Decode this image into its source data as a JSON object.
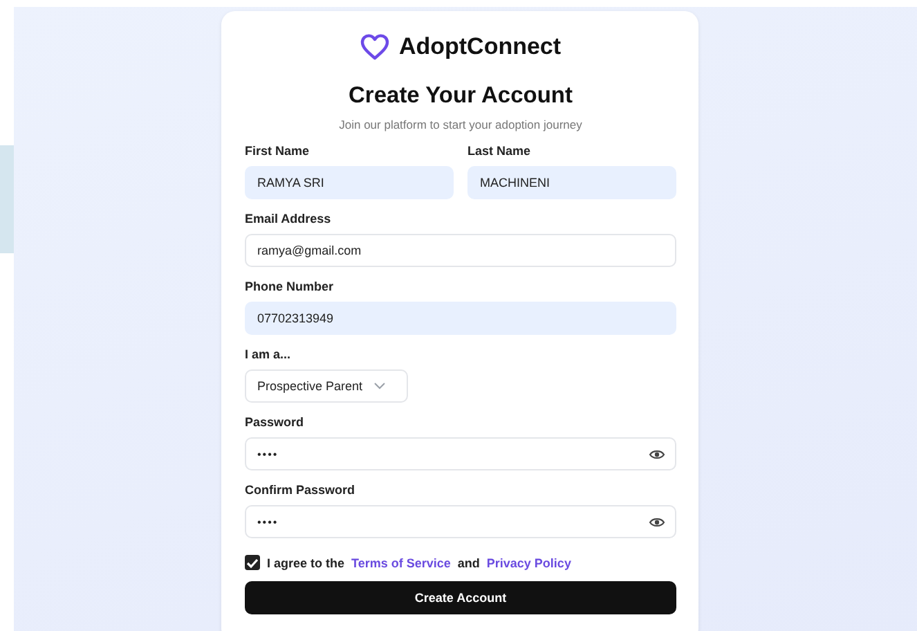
{
  "brand": {
    "name": "AdoptConnect"
  },
  "heading": "Create Your Account",
  "subtitle": "Join our platform to start your adoption journey",
  "rows": [
    {
      "fields": [
        {
          "kind": "text",
          "label": "First Name",
          "value": "RAMYA SRI",
          "autofilled": true
        },
        {
          "kind": "text",
          "label": "Last Name",
          "value": "MACHINENI",
          "autofilled": true
        }
      ]
    },
    {
      "fields": [
        {
          "kind": "text",
          "label": "Email Address",
          "value": "ramya@gmail.com",
          "autofilled": false
        }
      ]
    },
    {
      "fields": [
        {
          "kind": "text",
          "label": "Phone Number",
          "value": "07702313949",
          "autofilled": true
        }
      ]
    },
    {
      "fields": [
        {
          "kind": "select",
          "label": "I am a...",
          "value": "Prospective Parent",
          "autofilled": false
        }
      ]
    },
    {
      "fields": [
        {
          "kind": "password",
          "label": "Password",
          "value": "••••",
          "autofilled": false
        }
      ]
    },
    {
      "fields": [
        {
          "kind": "password",
          "label": "Confirm Password",
          "value": "••••",
          "autofilled": false
        }
      ]
    }
  ],
  "agreement": {
    "checked": true,
    "text_1": "I agree to the",
    "link_1": "Terms of Service",
    "text_2": "and",
    "link_2": "Privacy Policy"
  },
  "submit": "Create Account"
}
